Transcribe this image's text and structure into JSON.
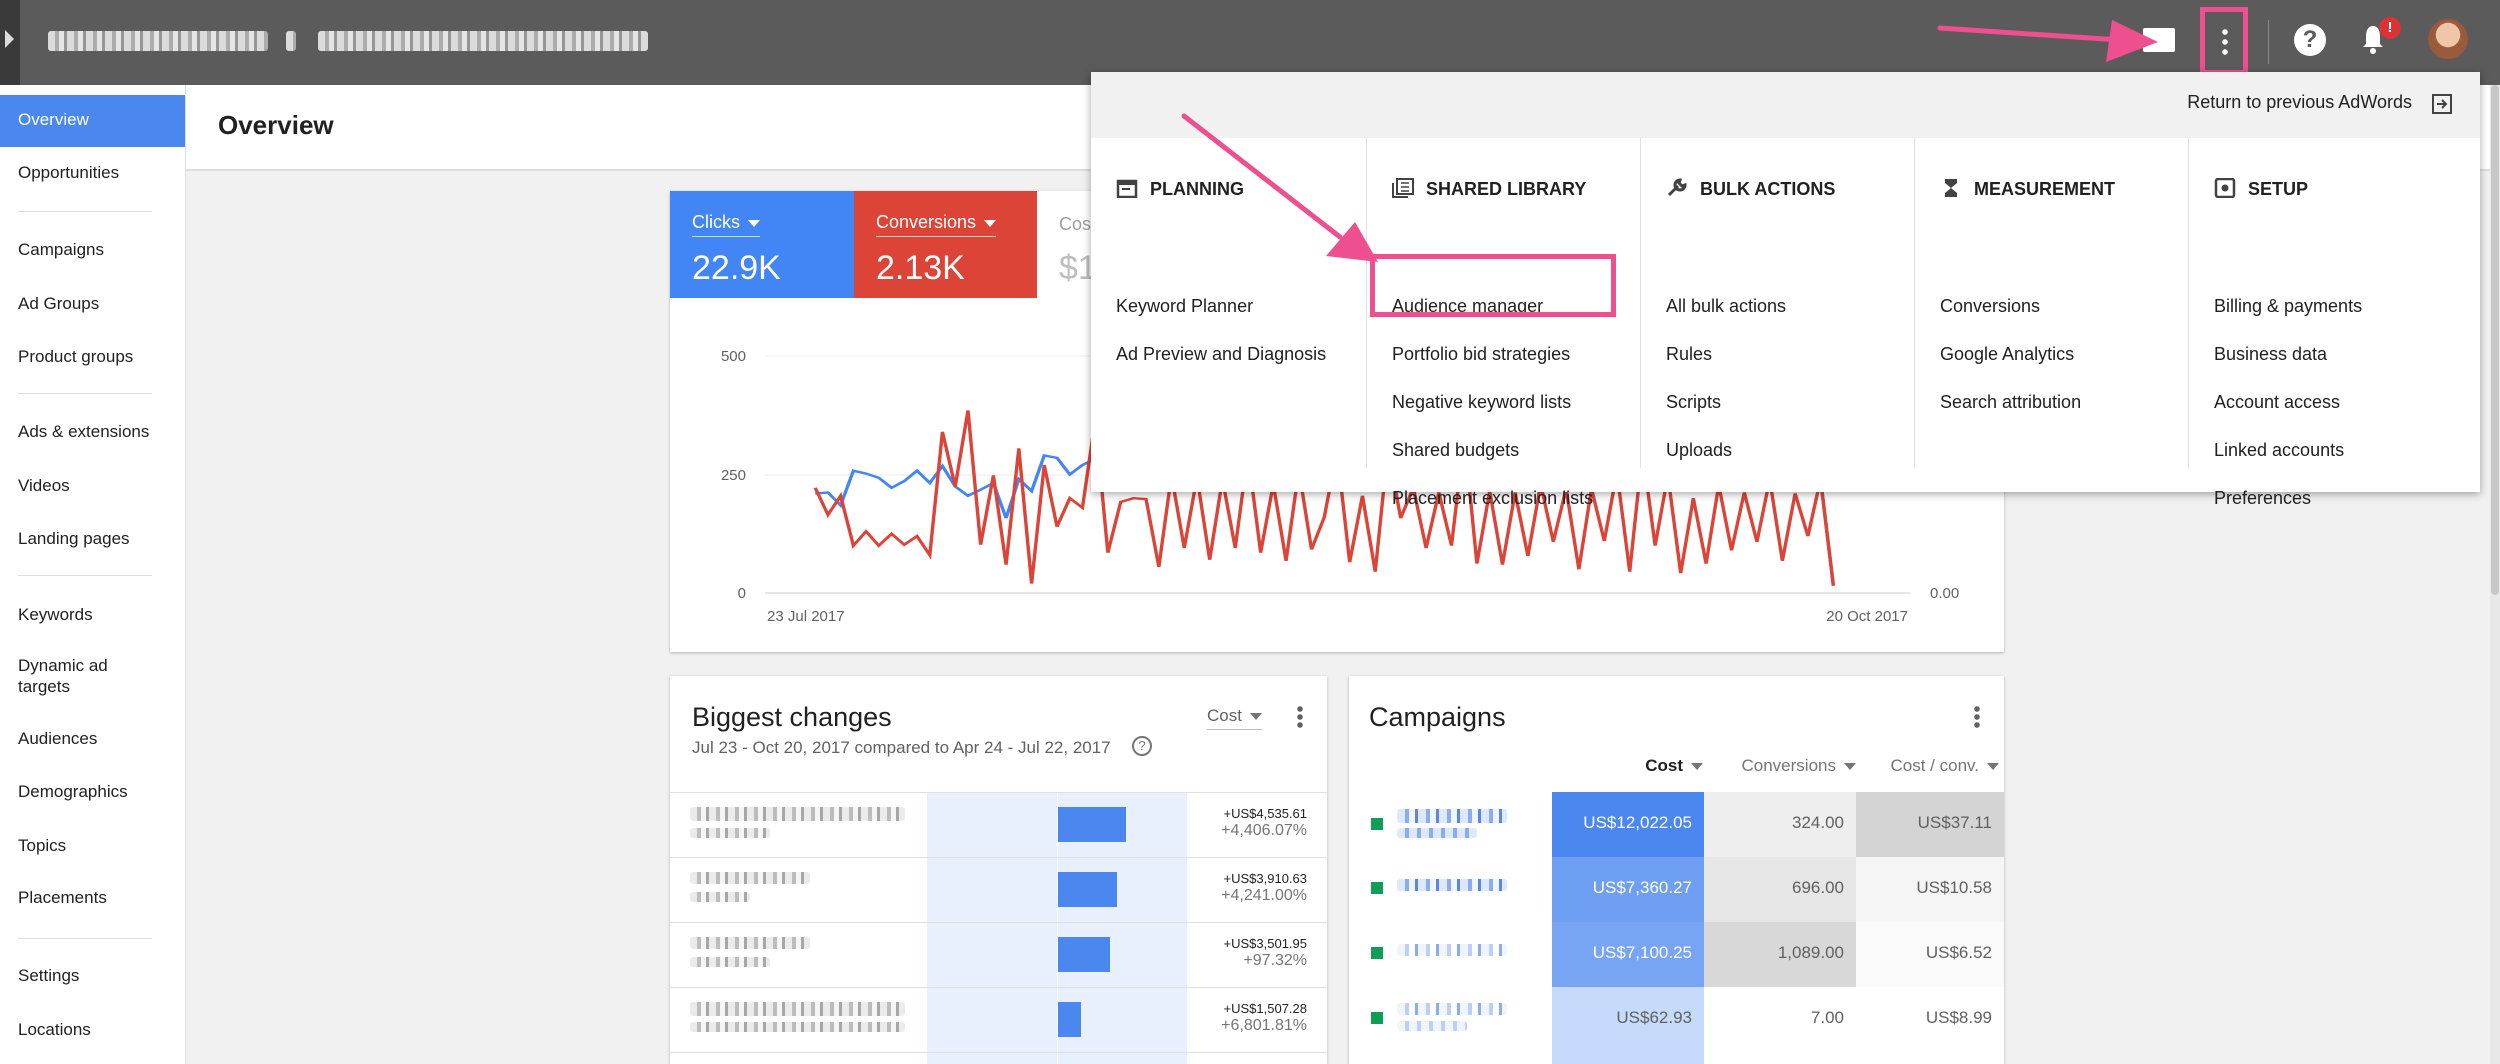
{
  "header": {
    "page_title": "Overview"
  },
  "sidebar": {
    "items": [
      {
        "label": "Overview",
        "active": true
      },
      {
        "label": "Opportunities"
      },
      {
        "label": "Campaigns"
      },
      {
        "label": "Ad Groups"
      },
      {
        "label": "Product groups"
      },
      {
        "label": "Ads & extensions"
      },
      {
        "label": "Videos"
      },
      {
        "label": "Landing pages"
      },
      {
        "label": "Keywords"
      },
      {
        "label": "Dynamic ad targets"
      },
      {
        "label": "Audiences"
      },
      {
        "label": "Demographics"
      },
      {
        "label": "Topics"
      },
      {
        "label": "Placements"
      },
      {
        "label": "Settings"
      },
      {
        "label": "Locations"
      }
    ]
  },
  "topbar": {
    "notification_badge": "!"
  },
  "chart": {
    "kpis": [
      {
        "label": "Clicks",
        "value": "22.9K",
        "color": "#4285f4"
      },
      {
        "label": "Conversions",
        "value": "2.13K",
        "color": "#db4437"
      },
      {
        "label": "Cos",
        "value": "$1"
      }
    ],
    "y_ticks": [
      "500",
      "250",
      "0"
    ],
    "right_tick": "0.00",
    "x_start": "23 Jul 2017",
    "x_end": "20 Oct 2017"
  },
  "chart_data": {
    "type": "line",
    "xlabel": "",
    "ylabel": "",
    "ylim": [
      0,
      500
    ],
    "x": [
      "23 Jul 2017",
      "20 Oct 2017"
    ],
    "series": [
      {
        "color": "#4285f4",
        "values": [
          210,
          212,
          185,
          258,
          252,
          243,
          222,
          236,
          258,
          232,
          268,
          225,
          205,
          218,
          232,
          158,
          240,
          215,
          290,
          285,
          250,
          270,
          283,
          275,
          265,
          255,
          248,
          232,
          240,
          230,
          226,
          232,
          252,
          248,
          245,
          238,
          230,
          245,
          252,
          240,
          234,
          238,
          232,
          245,
          238,
          240,
          236,
          232,
          230,
          242,
          238,
          248,
          236,
          238,
          232,
          230,
          226,
          236,
          240,
          238,
          232,
          228,
          230,
          240,
          236,
          232,
          238,
          230,
          236,
          230,
          240,
          232,
          226,
          228,
          236,
          240,
          228,
          234,
          238,
          240,
          18
        ]
      },
      {
        "color": "#db4437",
        "values": [
          222,
          165,
          205,
          100,
          130,
          100,
          125,
          102,
          120,
          80,
          340,
          225,
          385,
          102,
          248,
          60,
          305,
          20,
          270,
          140,
          200,
          180,
          365,
          85,
          192,
          200,
          198,
          55,
          248,
          95,
          245,
          70,
          240,
          95,
          295,
          85,
          230,
          68,
          260,
          92,
          160,
          300,
          65,
          205,
          45,
          305,
          158,
          222,
          95,
          212,
          100,
          330,
          62,
          215,
          60,
          212,
          78,
          230,
          108,
          220,
          50,
          220,
          110,
          255,
          45,
          300,
          100,
          248,
          42,
          200,
          62,
          228,
          90,
          212,
          108,
          240,
          68,
          210,
          120,
          240,
          15
        ]
      }
    ]
  },
  "menu": {
    "return_label": "Return to previous AdWords",
    "columns": [
      {
        "heading": "PLANNING",
        "icon": "calendar-icon",
        "links": [
          "Keyword Planner",
          "Ad Preview and Diagnosis"
        ]
      },
      {
        "heading": "SHARED LIBRARY",
        "icon": "library-icon",
        "links": [
          "Audience manager",
          "Portfolio bid strategies",
          "Negative keyword lists",
          "Shared budgets",
          "Placement exclusion lists"
        ]
      },
      {
        "heading": "BULK ACTIONS",
        "icon": "wrench-icon",
        "links": [
          "All bulk actions",
          "Rules",
          "Scripts",
          "Uploads"
        ]
      },
      {
        "heading": "MEASUREMENT",
        "icon": "hourglass-icon",
        "links": [
          "Conversions",
          "Google Analytics",
          "Search attribution"
        ]
      },
      {
        "heading": "SETUP",
        "icon": "settings-icon",
        "links": [
          "Billing & payments",
          "Business data",
          "Account access",
          "Linked accounts",
          "Preferences"
        ]
      }
    ]
  },
  "biggest_changes": {
    "title": "Biggest changes",
    "subtitle": "Jul 23 - Oct 20, 2017 compared to Apr 24 - Jul 22, 2017",
    "metric": "Cost",
    "rows": [
      {
        "amount": "+US$4,535.61",
        "pct": "+4,406.07%",
        "share": 1.0
      },
      {
        "amount": "+US$3,910.63",
        "pct": "+4,241.00%",
        "share": 0.862
      },
      {
        "amount": "+US$3,501.95",
        "pct": "+97.32%",
        "share": 0.772
      },
      {
        "amount": "+US$1,507.28",
        "pct": "+6,801.81%",
        "share": 0.332
      }
    ]
  },
  "campaigns": {
    "title": "Campaigns",
    "columns": [
      "Cost",
      "Conversions",
      "Cost / conv."
    ],
    "rows": [
      {
        "cost": "US$12,022.05",
        "conv": "324.00",
        "cpc": "US$37.11"
      },
      {
        "cost": "US$7,360.27",
        "conv": "696.00",
        "cpc": "US$10.58"
      },
      {
        "cost": "US$7,100.25",
        "conv": "1,089.00",
        "cpc": "US$6.52"
      },
      {
        "cost": "US$62.93",
        "conv": "7.00",
        "cpc": "US$8.99"
      }
    ]
  }
}
